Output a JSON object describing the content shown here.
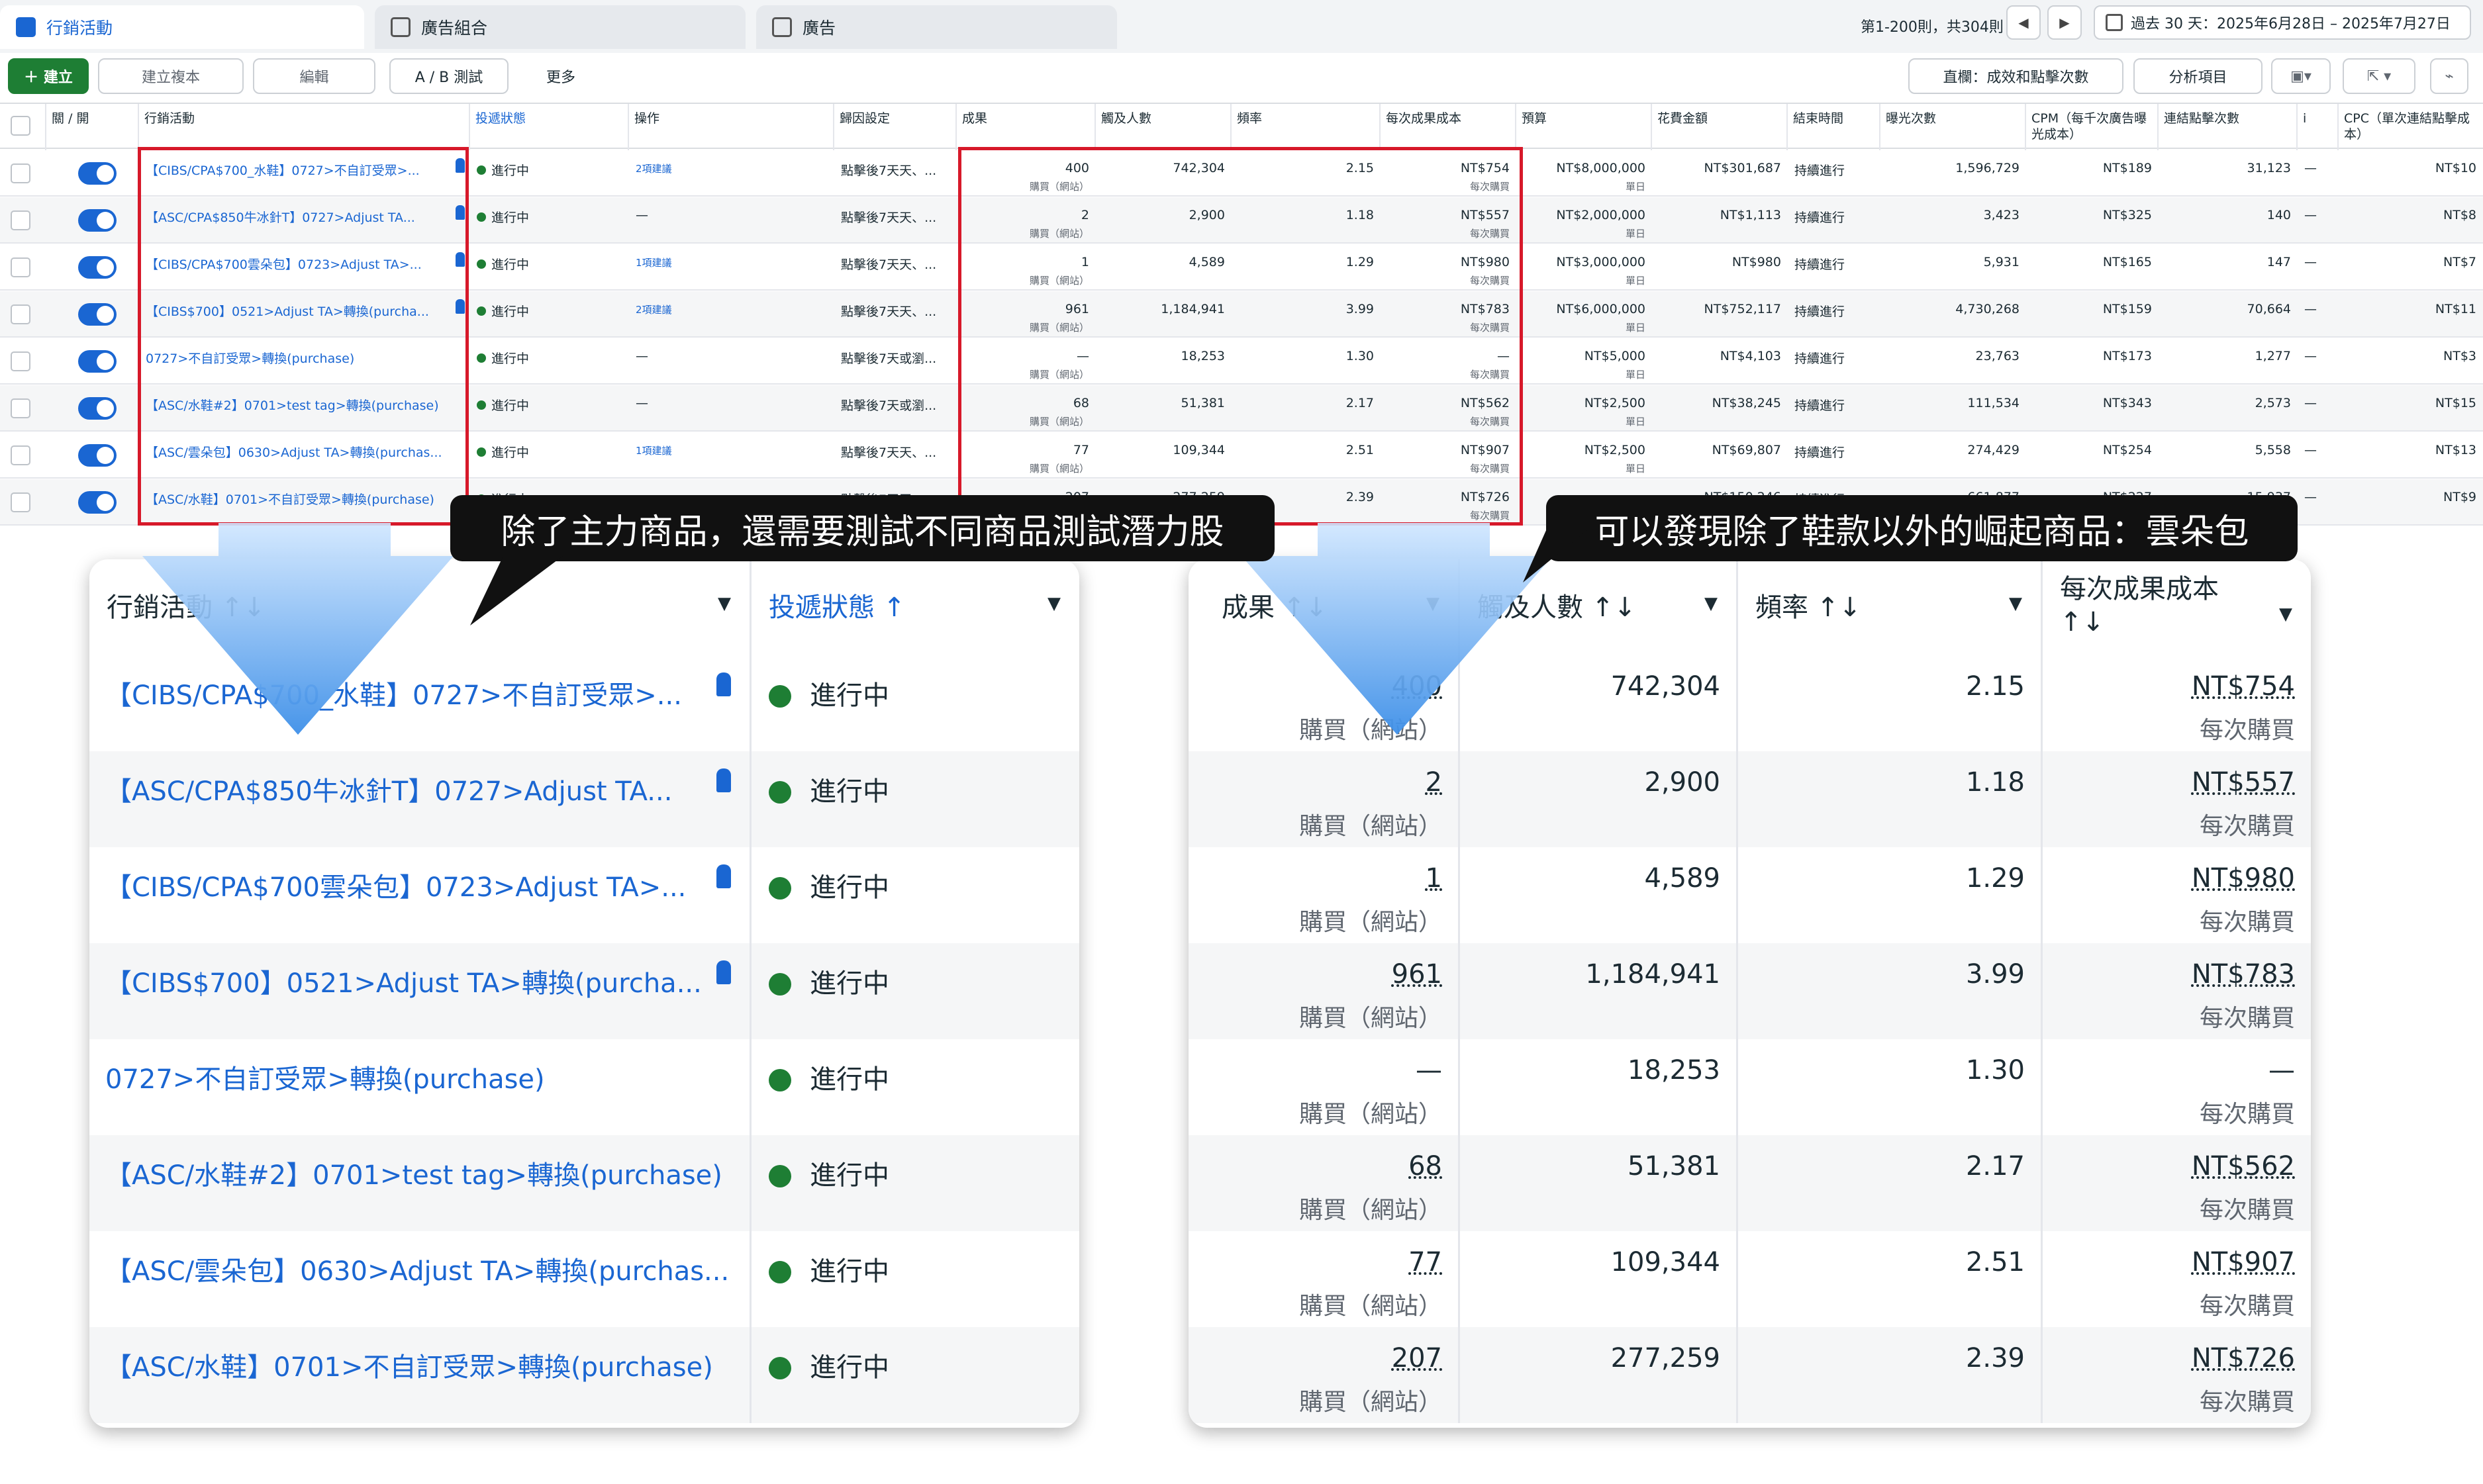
{
  "tabs": [
    {
      "label": "行銷活動",
      "icon": "campaigns-icon"
    },
    {
      "label": "廣告組合",
      "icon": "adsets-icon"
    },
    {
      "label": "廣告",
      "icon": "ads-icon"
    }
  ],
  "pager": {
    "range": "第1-200則，共304則",
    "date_range": "過去 30 天：2025年6月28日 – 2025年7月27日"
  },
  "toolbar": {
    "create": "＋ 建立",
    "duplicate": "建立複本",
    "edit": "編輯",
    "ab_test": "A / B 測試",
    "more": "更多",
    "columns": "直欄：成效和點擊次數",
    "breakdown": "分析項目"
  },
  "grid_headers": [
    "關 / 開",
    "行銷活動",
    "投遞狀態",
    "操作",
    "歸因設定",
    "成果",
    "觸及人數",
    "頻率",
    "每次成果成本",
    "預算",
    "花費金額",
    "結束時間",
    "曝光次數",
    "CPM（每千次廣告曝光成本）",
    "連結點擊次數",
    "CPC（單次連結點擊成本）"
  ],
  "rows": [
    {
      "name": "【CIBS/CPA$700_水鞋】0727>不自訂受眾>...",
      "status": "進行中",
      "recs": "2項建議",
      "attr": "點擊後7天天、...",
      "result": "400",
      "reach": "742,304",
      "freq": "2.15",
      "cpr": "NT$754",
      "budget": "NT$8,000,000",
      "spent": "NT$301,687",
      "end": "持續進行",
      "impr": "1,596,729",
      "cpm": "NT$189",
      "clicks": "31,123",
      "cpc": "NT$10"
    },
    {
      "name": "【ASC/CPA$850牛冰針T】0727>Adjust TA...",
      "status": "進行中",
      "recs": "—",
      "attr": "點擊後7天天、...",
      "result": "2",
      "reach": "2,900",
      "freq": "1.18",
      "cpr": "NT$557",
      "budget": "NT$2,000,000",
      "spent": "NT$1,113",
      "end": "持續進行",
      "impr": "3,423",
      "cpm": "NT$325",
      "clicks": "140",
      "cpc": "NT$8"
    },
    {
      "name": "【CIBS/CPA$700雲朵包】0723>Adjust TA>...",
      "status": "進行中",
      "recs": "1項建議",
      "attr": "點擊後7天天、...",
      "result": "1",
      "reach": "4,589",
      "freq": "1.29",
      "cpr": "NT$980",
      "budget": "NT$3,000,000",
      "spent": "NT$980",
      "end": "持續進行",
      "impr": "5,931",
      "cpm": "NT$165",
      "clicks": "147",
      "cpc": "NT$7"
    },
    {
      "name": "【CIBS$700】0521>Adjust TA>轉換(purcha...",
      "status": "進行中",
      "recs": "2項建議",
      "attr": "點擊後7天天、...",
      "result": "961",
      "reach": "1,184,941",
      "freq": "3.99",
      "cpr": "NT$783",
      "budget": "NT$6,000,000",
      "spent": "NT$752,117",
      "end": "持續進行",
      "impr": "4,730,268",
      "cpm": "NT$159",
      "clicks": "70,664",
      "cpc": "NT$11"
    },
    {
      "name": "0727>不自訂受眾>轉換(purchase)",
      "status": "進行中",
      "recs": "—",
      "attr": "點擊後7天或瀏...",
      "result": "—",
      "reach": "18,253",
      "freq": "1.30",
      "cpr": "—",
      "budget": "NT$5,000",
      "spent": "NT$4,103",
      "end": "持續進行",
      "impr": "23,763",
      "cpm": "NT$173",
      "clicks": "1,277",
      "cpc": "NT$3"
    },
    {
      "name": "【ASC/水鞋#2】0701>test tag>轉換(purchase)",
      "status": "進行中",
      "recs": "—",
      "attr": "點擊後7天或瀏...",
      "result": "68",
      "reach": "51,381",
      "freq": "2.17",
      "cpr": "NT$562",
      "budget": "NT$2,500",
      "spent": "NT$38,245",
      "end": "持續進行",
      "impr": "111,534",
      "cpm": "NT$343",
      "clicks": "2,573",
      "cpc": "NT$15"
    },
    {
      "name": "【ASC/雲朵包】0630>Adjust TA>轉換(purchas...",
      "status": "進行中",
      "recs": "1項建議",
      "attr": "點擊後7天天、...",
      "result": "77",
      "reach": "109,344",
      "freq": "2.51",
      "cpr": "NT$907",
      "budget": "NT$2,500",
      "spent": "NT$69,807",
      "end": "持續進行",
      "impr": "274,429",
      "cpm": "NT$254",
      "clicks": "5,558",
      "cpc": "NT$13"
    },
    {
      "name": "【ASC/水鞋】0701>不自訂受眾>轉換(purchase)",
      "status": "進行中",
      "recs": "",
      "attr": "點擊後7天天、...",
      "result": "207",
      "reach": "277,259",
      "freq": "2.39",
      "cpr": "NT$726",
      "budget": "",
      "spent": "NT$150,246",
      "end": "持續進行",
      "impr": "661,877",
      "cpm": "NT$227",
      "clicks": "15,937",
      "cpc": "NT$9"
    }
  ],
  "units": {
    "result": "購買（網站）",
    "cpr": "每次購買",
    "budget": "單日"
  },
  "callouts": {
    "left": "除了主力商品，還需要測試不同商品測試潛力股",
    "right": "可以發現除了鞋款以外的崛起商品：雲朵包"
  },
  "zoom_left": {
    "headers": {
      "campaign": "行銷活動 ↑↓",
      "status": "投遞狀態 ↑"
    },
    "rows": [
      {
        "name": "【CIBS/CPA$700_水鞋】0727>不自訂受眾>...",
        "status": "進行中",
        "pinned": true
      },
      {
        "name": "【ASC/CPA$850牛冰針T】0727>Adjust TA...",
        "status": "進行中",
        "pinned": true
      },
      {
        "name": "【CIBS/CPA$700雲朵包】0723>Adjust TA>...",
        "status": "進行中",
        "pinned": true
      },
      {
        "name": "【CIBS$700】0521>Adjust TA>轉換(purcha...",
        "status": "進行中",
        "pinned": true
      },
      {
        "name": "0727>不自訂受眾>轉換(purchase)",
        "status": "進行中",
        "pinned": false
      },
      {
        "name": "【ASC/水鞋#2】0701>test tag>轉換(purchase)",
        "status": "進行中",
        "pinned": false
      },
      {
        "name": "【ASC/雲朵包】0630>Adjust TA>轉換(purchas...",
        "status": "進行中",
        "pinned": false
      },
      {
        "name": "【ASC/水鞋】0701>不自訂受眾>轉換(purchase)",
        "status": "進行中",
        "pinned": false
      }
    ]
  },
  "zoom_right": {
    "headers": {
      "result": "成果 ↑↓",
      "reach": "觸及人數 ↑↓",
      "freq": "頻率 ↑↓",
      "cpr_line1": "每次成果成本",
      "cpr_line2": "↑↓"
    },
    "rows": [
      {
        "result": "400",
        "reach": "742,304",
        "freq": "2.15",
        "cpr": "NT$754"
      },
      {
        "result": "2",
        "reach": "2,900",
        "freq": "1.18",
        "cpr": "NT$557"
      },
      {
        "result": "1",
        "reach": "4,589",
        "freq": "1.29",
        "cpr": "NT$980"
      },
      {
        "result": "961",
        "reach": "1,184,941",
        "freq": "3.99",
        "cpr": "NT$783"
      },
      {
        "result": "—",
        "reach": "18,253",
        "freq": "1.30",
        "cpr": "—"
      },
      {
        "result": "68",
        "reach": "51,381",
        "freq": "2.17",
        "cpr": "NT$562"
      },
      {
        "result": "77",
        "reach": "109,344",
        "freq": "2.51",
        "cpr": "NT$907"
      },
      {
        "result": "207",
        "reach": "277,259",
        "freq": "2.39",
        "cpr": "NT$726"
      }
    ],
    "result_unit": "購買（網站）",
    "cpr_unit": "每次購買"
  },
  "colors": {
    "accent": "#1a66d2",
    "active": "#1e7e34",
    "highlight": "#d7192a",
    "arrow": "#5aa8f0"
  }
}
